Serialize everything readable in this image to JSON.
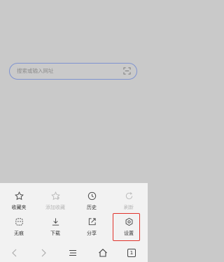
{
  "search": {
    "placeholder": "搜索或输入网址"
  },
  "menu": {
    "row1": [
      {
        "label": "收藏夹",
        "icon": "star-icon",
        "enabled": true
      },
      {
        "label": "添加收藏",
        "icon": "star-add-icon",
        "enabled": false
      },
      {
        "label": "历史",
        "icon": "clock-icon",
        "enabled": true
      },
      {
        "label": "刷新",
        "icon": "refresh-icon",
        "enabled": false
      }
    ],
    "row2": [
      {
        "label": "无痕",
        "icon": "incognito-icon",
        "enabled": true
      },
      {
        "label": "下载",
        "icon": "download-icon",
        "enabled": true
      },
      {
        "label": "分享",
        "icon": "share-icon",
        "enabled": true
      },
      {
        "label": "设置",
        "icon": "gear-icon",
        "enabled": true
      }
    ]
  },
  "bottom_nav": {
    "tab_count": "1",
    "icons": [
      "back-icon",
      "forward-icon",
      "menu-icon",
      "home-icon",
      "tabs-icon"
    ]
  },
  "colors": {
    "highlight": "#e0332b",
    "search_border": "#7f93d0"
  }
}
